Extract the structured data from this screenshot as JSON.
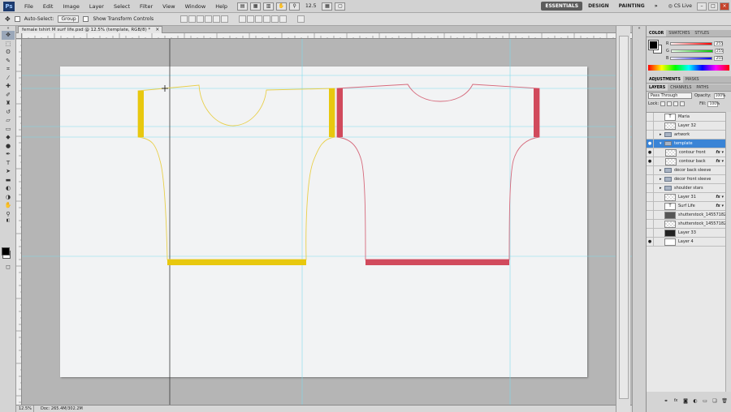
{
  "app": {
    "menu": [
      "File",
      "Edit",
      "Image",
      "Layer",
      "Select",
      "Filter",
      "View",
      "Window",
      "Help"
    ],
    "zoom_display": "12.5",
    "workspaces": [
      "ESSENTIALS",
      "DESIGN",
      "PAINTING"
    ],
    "more": "»",
    "cs_live": "CS Live"
  },
  "options_bar": {
    "auto_select_label": "Auto-Select:",
    "auto_select_value": "Group",
    "transform_label": "Show Transform Controls"
  },
  "document": {
    "tab_title": "female tshirt M surf life.psd @ 12.5% (template, RGB/8) *",
    "zoom": "12.5%",
    "doc_info": "Doc: 265.4M/302.2M"
  },
  "colors": {
    "yellow": "#e8c80e",
    "yellow_line": "#e8cf4a",
    "red": "#d14a5c",
    "red_line": "#d66a7c",
    "guide": "#7fdcec"
  },
  "color_panel": {
    "tabs": [
      "COLOR",
      "SWATCHES",
      "STYLES"
    ],
    "channels": [
      {
        "label": "R",
        "value": "255"
      },
      {
        "label": "G",
        "value": "255"
      },
      {
        "label": "B",
        "value": "255"
      }
    ]
  },
  "adjustments_panel": {
    "tabs": [
      "ADJUSTMENTS",
      "MASKS"
    ]
  },
  "layers_panel": {
    "tabs": [
      "LAYERS",
      "CHANNELS",
      "PATHS"
    ],
    "blend_mode": "Pass Through",
    "opacity_label": "Opacity:",
    "opacity": "100%",
    "lock_label": "Lock:",
    "fill_label": "Fill:",
    "fill": "100%",
    "layers": [
      {
        "name": "Maria",
        "kind": "text",
        "visible": false,
        "indent": 0,
        "fx": false
      },
      {
        "name": "Layer 32",
        "kind": "layer",
        "visible": false,
        "indent": 0,
        "fx": false
      },
      {
        "name": "artwork",
        "kind": "group",
        "visible": false,
        "indent": 0,
        "fx": false
      },
      {
        "name": "template",
        "kind": "group",
        "visible": true,
        "indent": 0,
        "fx": false,
        "selected": true
      },
      {
        "name": "contour front",
        "kind": "layer",
        "visible": true,
        "indent": 1,
        "fx": true
      },
      {
        "name": "contour back",
        "kind": "layer",
        "visible": true,
        "indent": 1,
        "fx": true
      },
      {
        "name": "décor back sleeve",
        "kind": "group",
        "visible": false,
        "indent": 1,
        "fx": false
      },
      {
        "name": "décor front sleeve",
        "kind": "group",
        "visible": false,
        "indent": 1,
        "fx": false
      },
      {
        "name": "shoulder stars",
        "kind": "group",
        "visible": false,
        "indent": 1,
        "fx": false
      },
      {
        "name": "Layer 31",
        "kind": "layer",
        "visible": false,
        "indent": 0,
        "fx": true
      },
      {
        "name": "Surf  Life",
        "kind": "text",
        "visible": false,
        "indent": 0,
        "fx": true
      },
      {
        "name": "shutterstock_145571821",
        "kind": "layer",
        "visible": false,
        "indent": 0,
        "fx": false
      },
      {
        "name": "shutterstock_145571821",
        "kind": "layer",
        "visible": false,
        "indent": 0,
        "fx": false
      },
      {
        "name": "Layer 33",
        "kind": "layer",
        "visible": false,
        "indent": 0,
        "fx": false
      },
      {
        "name": "Layer 4",
        "kind": "layer",
        "visible": true,
        "indent": 0,
        "fx": false
      }
    ]
  }
}
